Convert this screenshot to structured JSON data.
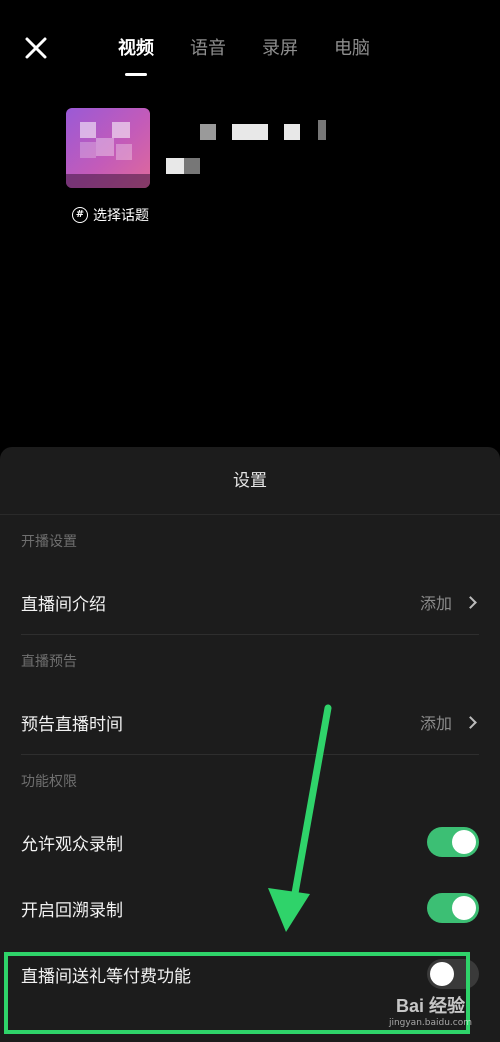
{
  "header": {
    "close_icon": "close-icon",
    "tabs": [
      {
        "label": "视频",
        "active": true
      },
      {
        "label": "语音",
        "active": false
      },
      {
        "label": "录屏",
        "active": false
      },
      {
        "label": "电脑",
        "active": false
      }
    ]
  },
  "topic": {
    "icon": "hashtag-icon",
    "label": "选择话题"
  },
  "settings": {
    "title": "设置",
    "sections": [
      {
        "label": "开播设置"
      },
      {
        "label": "直播预告"
      },
      {
        "label": "功能权限"
      }
    ],
    "rows": {
      "intro": {
        "label": "直播间介绍",
        "action": "添加"
      },
      "preview_time": {
        "label": "预告直播时间",
        "action": "添加"
      },
      "allow_record": {
        "label": "允许观众录制",
        "enabled": true
      },
      "replay_record": {
        "label": "开启回溯录制",
        "enabled": true
      },
      "paid_features": {
        "label": "直播间送礼等付费功能",
        "enabled": false
      }
    }
  },
  "annotation": {
    "color": "#2fd36a"
  },
  "watermark": {
    "main": "Bai 经验",
    "sub": "jingyan.baidu.com"
  },
  "colors": {
    "toggle_on": "#3cbf74",
    "toggle_off": "#3a3a3a",
    "sheet_bg": "#1c1c1c"
  }
}
